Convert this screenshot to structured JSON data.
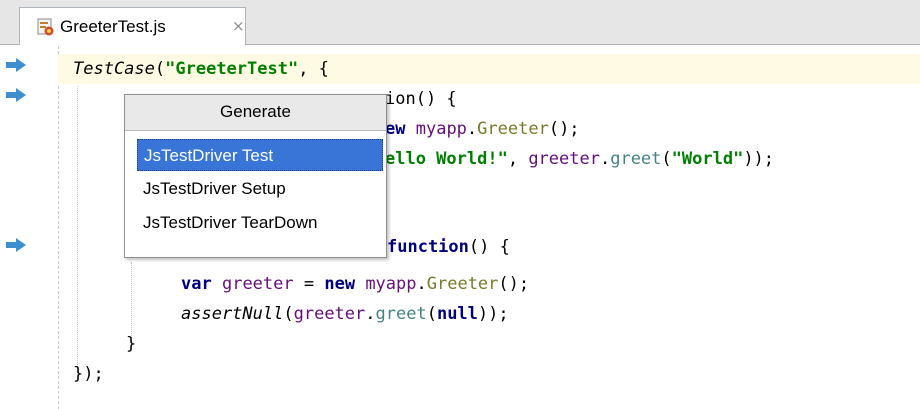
{
  "tab": {
    "label": "GreeterTest.js",
    "close": "×"
  },
  "popup": {
    "title": "Generate",
    "items": [
      "JsTestDriver Test",
      "JsTestDriver Setup",
      "JsTestDriver TearDown"
    ],
    "selected_index": 0
  },
  "code": {
    "l1_fn": "TestCase",
    "l1_open": "(",
    "l1_str": "\"GreeterTest\"",
    "l1_rest": ", {",
    "l2_tail": "ion() {",
    "l3_tail_kw": "ew",
    "l3_obj": "myapp",
    "l3_dot": ".",
    "l3_cls": "Greeter",
    "l3_end": "();",
    "l4_str": "ello World!\"",
    "l4_mid": ", ",
    "l4_var": "greeter",
    "l4_dot": ".",
    "l4_method": "greet",
    "l4_open": "(",
    "l4_arg": "\"World\"",
    "l4_end": "));",
    "l6_kw": "function",
    "l6_end": "() {",
    "l7_var_kw": "var",
    "l7_name": "greeter",
    "l7_eq": " = ",
    "l7_new": "new",
    "l7_obj": "myapp",
    "l7_dot": ".",
    "l7_cls": "Greeter",
    "l7_end": "();",
    "l8_fn": "assertNull",
    "l8_open": "(",
    "l8_var": "greeter",
    "l8_dot": ".",
    "l8_method": "greet",
    "l8_open2": "(",
    "l8_null": "null",
    "l8_end": "));",
    "l9": "}",
    "l10": "});"
  },
  "colors": {
    "current_line": "#fffae3",
    "arrow": "#3d8fd1",
    "selection": "#3875d7"
  }
}
